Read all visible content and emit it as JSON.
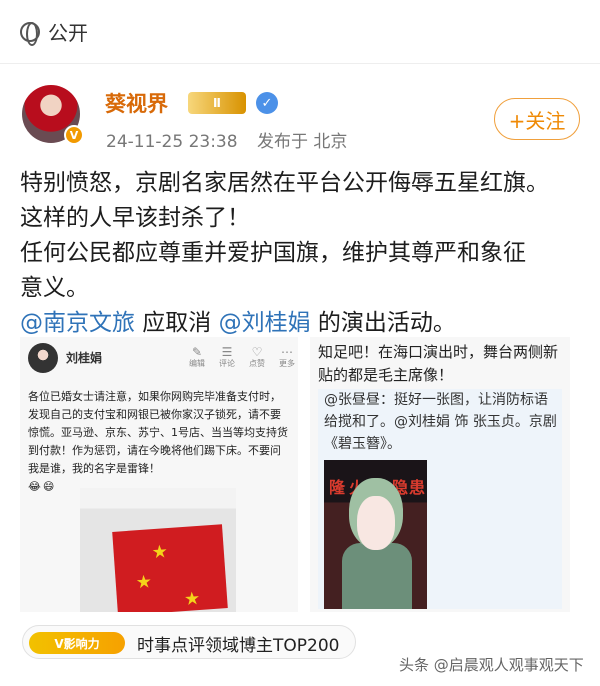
{
  "header": {
    "visibility": "公开"
  },
  "author": {
    "name": "葵视界",
    "level_badge": "Ⅱ",
    "date": "24-11-25 23:38",
    "location": "发布于 北京",
    "follow_label": "+关注"
  },
  "post": {
    "line1": "特别愤怒，京剧名家居然在平台公开侮辱五星红旗。",
    "line2": "这样的人早该封杀了！",
    "line3": "任何公民都应尊重并爱护国旗，维护其尊严和象征",
    "line4": "意义。",
    "mention1": "@南京文旅",
    "mid": " 应取消 ",
    "mention2": "@刘桂娟",
    "tail": " 的演出活动。"
  },
  "left_card": {
    "name": "刘桂娟",
    "actions": [
      "编辑",
      "评论",
      "点赞",
      "更多"
    ],
    "text": "各位已婚女士请注意，如果你网购完毕准备支付时，发现自己的支付宝和网银已被你家汉子锁死，请不要惊慌。亚马逊、京东、苏宁、1号店、当当等均支持货到付款！作为惩罚，请在今晚将他们踢下床。不要问我是谁，我的名字是雷锋！"
  },
  "right_card": {
    "top_text": "知足吧！在海口演出时，舞台两侧新贴的都是毛主席像！",
    "quote": "@张昼昼：挺好一张图，让消防标语给搅和了。@刘桂娟 饰 张玉贞。京剧《碧玉簪》。",
    "stage_words": [
      "隆",
      "火",
      "隐",
      "患"
    ]
  },
  "footer": {
    "influence_logo": "V影响力",
    "influence_text": "时事点评领域博主TOP200",
    "watermark": "头条 @启晨观人观事观天下"
  },
  "colors": {
    "accent": "#ef8a06",
    "mention": "#2f73b8",
    "flag": "#d01c20"
  }
}
